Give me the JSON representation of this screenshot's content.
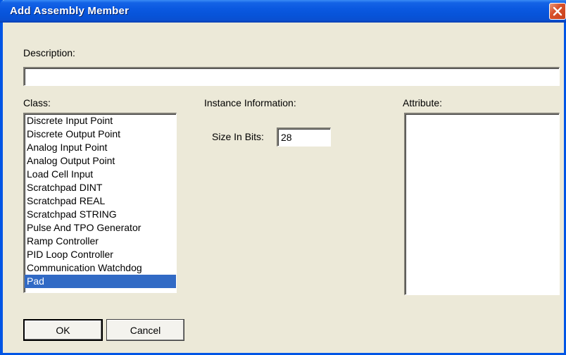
{
  "window": {
    "title": "Add Assembly Member"
  },
  "description": {
    "label": "Description:",
    "value": ""
  },
  "class": {
    "label": "Class:",
    "items": [
      "Discrete Input Point",
      "Discrete Output Point",
      "Analog Input Point",
      "Analog Output Point",
      "Load Cell Input",
      "Scratchpad DINT",
      "Scratchpad REAL",
      "Scratchpad STRING",
      "Pulse And TPO Generator",
      "Ramp Controller",
      "PID Loop Controller",
      "Communication Watchdog",
      "Pad"
    ],
    "selected": "Pad"
  },
  "instance": {
    "label": "Instance Information:",
    "size_label": "Size In Bits:",
    "size_value": "28"
  },
  "attribute": {
    "label": "Attribute:"
  },
  "buttons": {
    "ok": "OK",
    "cancel": "Cancel"
  },
  "colors": {
    "titlebar": "#0a58e0",
    "selection": "#316ac5",
    "dialog_bg": "#ece9d8",
    "close": "#d8522c"
  }
}
